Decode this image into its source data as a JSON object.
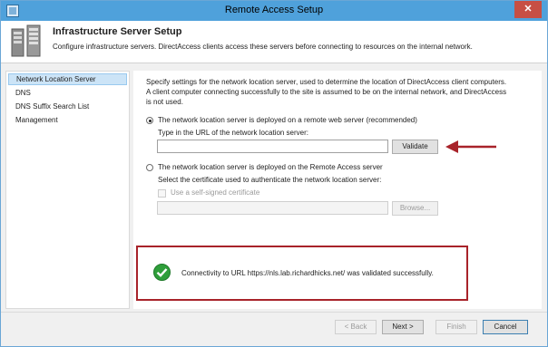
{
  "window": {
    "title": "Remote Access Setup",
    "close_glyph": "✕"
  },
  "header": {
    "title": "Infrastructure Server Setup",
    "description": "Configure infrastructure servers. DirectAccess clients access these servers before connecting to resources on the internal network."
  },
  "sidebar": {
    "items": [
      {
        "label": "Network Location Server",
        "selected": true
      },
      {
        "label": "DNS",
        "selected": false
      },
      {
        "label": "DNS Suffix Search List",
        "selected": false
      },
      {
        "label": "Management",
        "selected": false
      }
    ]
  },
  "main": {
    "intro": "Specify settings for the network location server, used to determine the location of DirectAccess client computers. A client computer connecting successfully to the site is assumed to be on the internal network, and DirectAccess is not used.",
    "option_remote": {
      "label": "The network location server is deployed on a remote web server (recommended)",
      "selected": true,
      "url_prompt": "Type in the URL of the network location server:",
      "url_value": "",
      "validate_label": "Validate"
    },
    "option_local": {
      "label": "The network location server is deployed on the Remote Access server",
      "selected": false,
      "cert_prompt": "Select the certificate used to authenticate the network location server:",
      "self_signed_label": "Use a self-signed certificate",
      "cert_value": "",
      "browse_label": "Browse..."
    },
    "status": {
      "icon": "check-circle-icon",
      "message": "Connectivity to URL https://nls.lab.richardhicks.net/ was validated successfully."
    }
  },
  "footer": {
    "back_label": "< Back",
    "next_label": "Next >",
    "finish_label": "Finish",
    "cancel_label": "Cancel"
  },
  "colors": {
    "titlebar": "#4fa1db",
    "close_button": "#c74f44",
    "highlight_border": "#a8232a",
    "annotation_arrow": "#a8232a",
    "success_green": "#2e9e3a",
    "selection": "#cce4f7"
  }
}
